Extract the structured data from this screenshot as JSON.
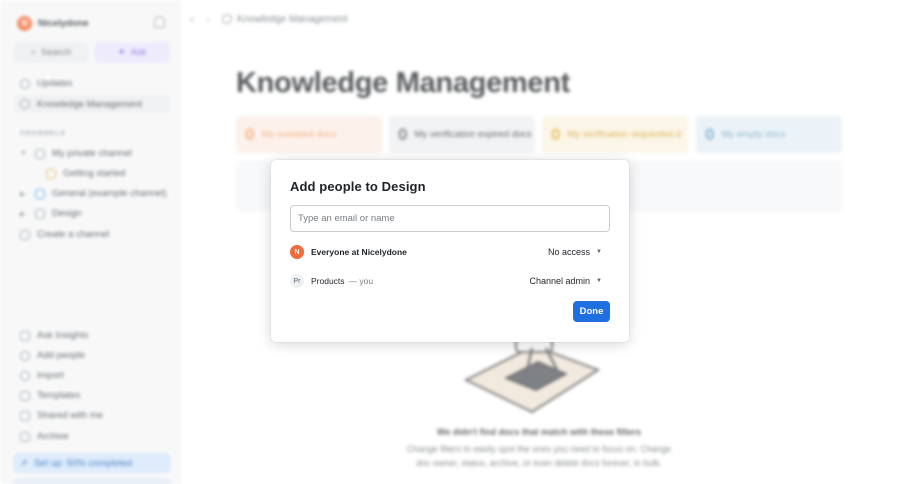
{
  "sidebar": {
    "workspace_name": "Nicelydone",
    "workspace_initial": "N",
    "search_label": "Search",
    "ask_label": "Ask",
    "nav": [
      {
        "label": "Updates"
      },
      {
        "label": "Knowledge Management"
      }
    ],
    "channels_heading": "CHANNELS",
    "channels": [
      {
        "label": "My private channel"
      },
      {
        "label": "Getting started"
      },
      {
        "label": "General (example channel)"
      },
      {
        "label": "Design"
      },
      {
        "label": "Create a channel"
      }
    ],
    "bottom": [
      {
        "label": "Ask Insights"
      },
      {
        "label": "Add people"
      },
      {
        "label": "Import"
      },
      {
        "label": "Templates"
      },
      {
        "label": "Shared with me"
      },
      {
        "label": "Archive"
      }
    ],
    "setup_label": "Set up: 50% completed"
  },
  "topbar": {
    "breadcrumb": "Knowledge Management"
  },
  "main": {
    "title": "Knowledge Management",
    "stats": [
      {
        "count": "0",
        "label": "My outdated docs",
        "color": "#f4a06b",
        "bg": "#fbefe6"
      },
      {
        "count": "0",
        "label": "My verification expired docs",
        "color": "#6a7075",
        "bg": "#eef0f2"
      },
      {
        "count": "0",
        "label": "My verification requested d",
        "color": "#e2b441",
        "bg": "#fbf4e3"
      },
      {
        "count": "0",
        "label": "My empty docs",
        "color": "#6fa3c8",
        "bg": "#e6f0f6"
      }
    ],
    "empty_title": "We didn't find docs that match with these filters",
    "empty_desc": "Change filters to easily spot the ones you need to focus on. Change doc owner, status, archive, or even delete docs forever, in bulk."
  },
  "modal": {
    "title": "Add people to Design",
    "input_placeholder": "Type an email or name",
    "rows": [
      {
        "avatar": "N",
        "name": "Everyone at Nicelydone",
        "suffix": "",
        "access": "No access"
      },
      {
        "avatar": "Pr",
        "name": "Products",
        "suffix": "— you",
        "access": "Channel admin"
      }
    ],
    "done_label": "Done"
  },
  "colors": {
    "accent": "#1f6fe0",
    "brand": "#f26b3a"
  }
}
